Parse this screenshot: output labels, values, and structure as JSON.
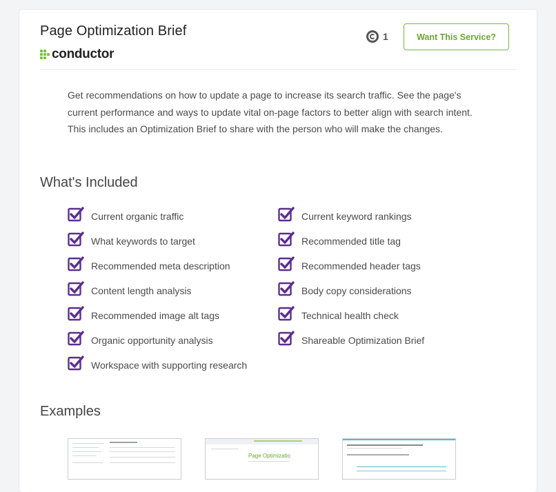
{
  "header": {
    "title": "Page Optimization Brief",
    "brand": "conductor",
    "credits": "1",
    "cta_label": "Want This Service?"
  },
  "description": "Get recommendations on how to update a page to increase its search traffic. See the page's current performance and ways to update vital on-page factors to better align with search intent. This includes an Optimization Brief to share with the person who will make the changes.",
  "included": {
    "heading": "What's Included",
    "items": [
      "Current organic traffic",
      "Current keyword rankings",
      "What keywords to target",
      "Recommended title tag",
      "Recommended meta description",
      "Recommended header tags",
      "Content length analysis",
      "Body copy considerations",
      "Recommended image alt tags",
      "Technical health check",
      "Organic opportunity analysis",
      "Shareable Optimization Brief",
      "Workspace with supporting research"
    ]
  },
  "examples": {
    "heading": "Examples",
    "thumbnails": [
      "example-1",
      "example-2",
      "example-3"
    ]
  },
  "colors": {
    "accent_green": "#7ab342",
    "check_purple": "#5b2d90",
    "card_bg": "#ffffff",
    "page_bg": "#f3f4f6"
  },
  "icons": {
    "credit": "credit-coin-icon",
    "check": "checkbox-checked-icon",
    "brand": "conductor-logo-dots"
  }
}
